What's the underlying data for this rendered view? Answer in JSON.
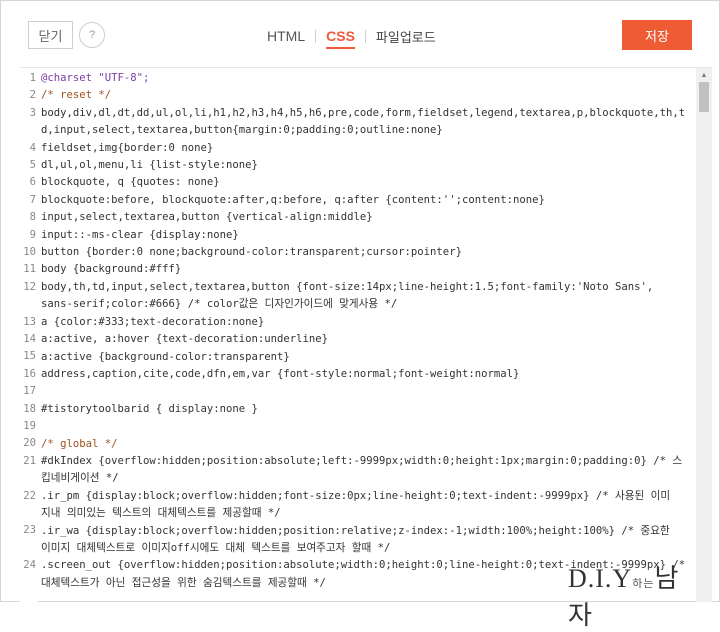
{
  "toolbar": {
    "close_label": "닫기",
    "help_label": "?",
    "tabs": [
      {
        "label": "HTML",
        "active": false
      },
      {
        "label": "CSS",
        "active": true
      },
      {
        "label": "파일업로드",
        "active": false
      }
    ],
    "save_label": "저장"
  },
  "colors": {
    "accent": "#ef5b35",
    "active_tab": "#f0583c"
  },
  "editor": {
    "lines": [
      {
        "n": "1",
        "text": "@charset \"UTF-8\";"
      },
      {
        "n": "2",
        "text": "/* reset */"
      },
      {
        "n": "3",
        "text": "body,div,dl,dt,dd,ul,ol,li,h1,h2,h3,h4,h5,h6,pre,code,form,fieldset,legend,textarea,p,blockquote,th,t"
      },
      {
        "n": "",
        "text": "d,input,select,textarea,button{margin:0;padding:0;outline:none}"
      },
      {
        "n": "4",
        "text": "fieldset,img{border:0 none}"
      },
      {
        "n": "5",
        "text": "dl,ul,ol,menu,li {list-style:none}"
      },
      {
        "n": "6",
        "text": "blockquote, q {quotes: none}"
      },
      {
        "n": "7",
        "text": "blockquote:before, blockquote:after,q:before, q:after {content:'';content:none}"
      },
      {
        "n": "8",
        "text": "input,select,textarea,button {vertical-align:middle}"
      },
      {
        "n": "9",
        "text": "input::-ms-clear {display:none}"
      },
      {
        "n": "10",
        "text": "button {border:0 none;background-color:transparent;cursor:pointer}"
      },
      {
        "n": "11",
        "text": "body {background:#fff}"
      },
      {
        "n": "12",
        "text": "body,th,td,input,select,textarea,button {font-size:14px;line-height:1.5;font-family:'Noto Sans',"
      },
      {
        "n": "",
        "text": "sans-serif;color:#666} /* color값은 디자인가이드에 맞게사용 */"
      },
      {
        "n": "13",
        "text": "a {color:#333;text-decoration:none}"
      },
      {
        "n": "14",
        "text": "a:active, a:hover {text-decoration:underline}"
      },
      {
        "n": "15",
        "text": "a:active {background-color:transparent}"
      },
      {
        "n": "16",
        "text": "address,caption,cite,code,dfn,em,var {font-style:normal;font-weight:normal}"
      },
      {
        "n": "17",
        "text": ""
      },
      {
        "n": "18",
        "text": "#tistorytoolbarid { display:none }"
      },
      {
        "n": "19",
        "text": ""
      },
      {
        "n": "20",
        "text": "/* global */"
      },
      {
        "n": "21",
        "text": "#dkIndex {overflow:hidden;position:absolute;left:-9999px;width:0;height:1px;margin:0;padding:0} /* 스"
      },
      {
        "n": "",
        "text": "킵네비게이션 */"
      },
      {
        "n": "22",
        "text": ".ir_pm {display:block;overflow:hidden;font-size:0px;line-height:0;text-indent:-9999px} /* 사용된 이미"
      },
      {
        "n": "",
        "text": "지내 의미있는 텍스트의 대체텍스트를 제공할때 */"
      },
      {
        "n": "23",
        "text": ".ir_wa {display:block;overflow:hidden;position:relative;z-index:-1;width:100%;height:100%} /* 중요한"
      },
      {
        "n": "",
        "text": "이미지 대체텍스트로 이미지off시에도 대체 텍스트를 보여주고자 할때 */"
      },
      {
        "n": "24",
        "text": ".screen_out {overflow:hidden;position:absolute;width:0;height:0;line-height:0;text-indent:-9999px} /*"
      },
      {
        "n": "",
        "text": "대체텍스트가 아닌 접근성을 위한 숨김텍스트를 제공할때 */"
      }
    ]
  },
  "watermark": {
    "text": "D.I.Y",
    "sub": "하는",
    "tail": "남자"
  }
}
